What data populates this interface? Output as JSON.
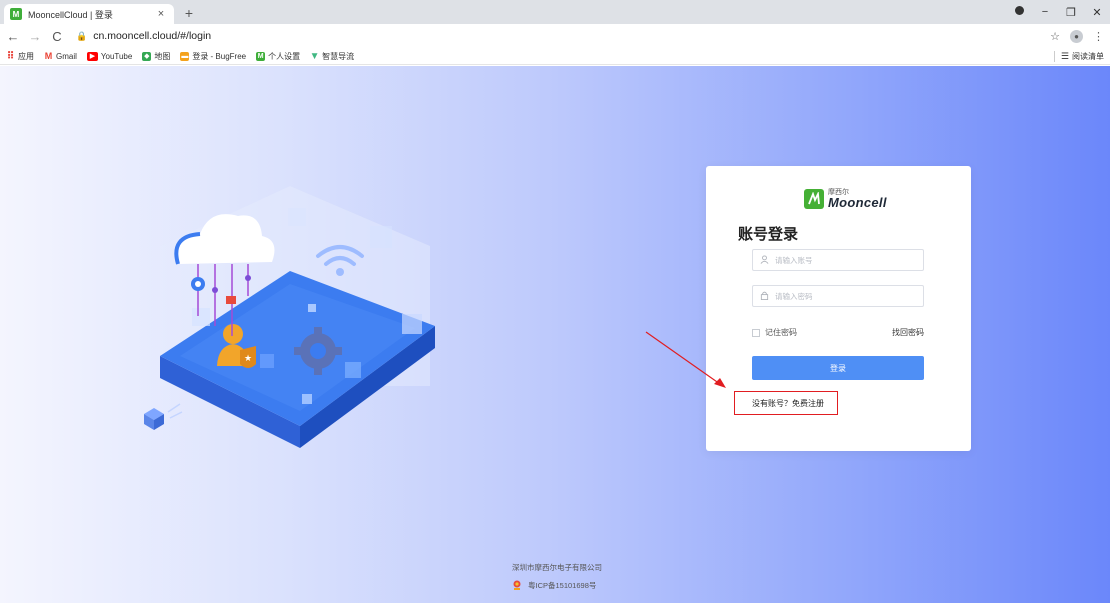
{
  "browser": {
    "tab_favicon": "Mooncell-logo",
    "tab_title": "MooncellCloud | 登录",
    "tab_close": "×",
    "new_tab": "+",
    "url": "cn.mooncell.cloud/#/login",
    "window_controls": {
      "minimize": "−",
      "restore": "❐",
      "close": "✕"
    },
    "bookmarks": [
      {
        "label": "应用",
        "icon": "apps-grid-icon",
        "color": "#e8453c"
      },
      {
        "label": "Gmail",
        "icon": "gmail-icon",
        "color": "#ea4335"
      },
      {
        "label": "YouTube",
        "icon": "youtube-icon",
        "color": "#ff0000"
      },
      {
        "label": "地图",
        "icon": "maps-icon",
        "color": "#34a853"
      },
      {
        "label": "登录 - BugFree",
        "icon": "bugfree-icon",
        "color": "#f4a21c"
      },
      {
        "label": "个人设置",
        "icon": "mooncell-icon",
        "color": "#3fae3a"
      },
      {
        "label": "智慧导流",
        "icon": "vue-icon",
        "color": "#41b883"
      }
    ],
    "reading_list": "阅读清单"
  },
  "login": {
    "logo_cn": "摩西尔",
    "logo_en": "Mooncell",
    "title": "账号登录",
    "account_placeholder": "请输入账号",
    "password_placeholder": "请输入密码",
    "remember_label": "记住密码",
    "forgot_label": "找回密码",
    "login_button": "登录",
    "register_text": "没有账号？免费注册"
  },
  "footer": {
    "company": "深圳市摩西尔电子有限公司",
    "icp": "粤ICP备15101698号"
  },
  "colors": {
    "primary_button": "#4f8ff5",
    "annotation_red": "#e11d21",
    "brand_green": "#45b035"
  }
}
